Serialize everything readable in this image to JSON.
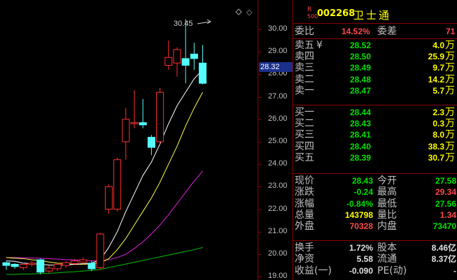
{
  "stock": {
    "market_flag": "R",
    "market_sub": "500",
    "code": "002268",
    "name": "卫士通"
  },
  "axis": {
    "ticks": [
      "30.00",
      "29.00",
      "28.00",
      "27.00",
      "26.00",
      "25.00",
      "24.00",
      "23.00",
      "22.00",
      "21.00",
      "20.00",
      "19.00"
    ],
    "current": "28.32"
  },
  "chart": {
    "peak_label": "30.45",
    "candles": [
      {
        "o": 19.62,
        "c": 19.5,
        "h": 19.68,
        "l": 19.3
      },
      {
        "o": 19.55,
        "c": 19.45,
        "h": 19.6,
        "l": 19.35
      },
      {
        "o": 19.4,
        "c": 19.55,
        "h": 19.62,
        "l": 19.3
      },
      {
        "o": 19.55,
        "c": 19.6,
        "h": 19.7,
        "l": 19.45
      },
      {
        "o": 19.75,
        "c": 19.2,
        "h": 19.8,
        "l": 19.1
      },
      {
        "o": 19.25,
        "c": 19.38,
        "h": 19.5,
        "l": 19.15
      },
      {
        "o": 19.35,
        "c": 19.55,
        "h": 19.62,
        "l": 19.25
      },
      {
        "o": 19.5,
        "c": 19.62,
        "h": 19.7,
        "l": 19.4
      },
      {
        "o": 19.58,
        "c": 19.7,
        "h": 19.78,
        "l": 19.5
      },
      {
        "o": 19.65,
        "c": 19.75,
        "h": 19.85,
        "l": 19.55
      },
      {
        "o": 19.6,
        "c": 19.35,
        "h": 19.7,
        "l": 19.25
      },
      {
        "o": 19.4,
        "c": 20.9,
        "h": 20.95,
        "l": 19.35
      },
      {
        "o": 22.0,
        "c": 23.0,
        "h": 23.1,
        "l": 21.8
      },
      {
        "o": 22.0,
        "c": 24.2,
        "h": 24.3,
        "l": 21.9
      },
      {
        "o": 25.0,
        "c": 26.0,
        "h": 26.5,
        "l": 24.2
      },
      {
        "o": 25.8,
        "c": 25.85,
        "h": 27.3,
        "l": 25.6
      },
      {
        "o": 25.85,
        "c": 25.75,
        "h": 26.9,
        "l": 25.6
      },
      {
        "o": 25.2,
        "c": 24.75,
        "h": 25.3,
        "l": 24.4
      },
      {
        "o": 25.0,
        "c": 27.2,
        "h": 27.4,
        "l": 24.9
      },
      {
        "o": 28.4,
        "c": 28.75,
        "h": 29.5,
        "l": 28.2
      },
      {
        "o": 28.5,
        "c": 29.1,
        "h": 29.2,
        "l": 27.9
      },
      {
        "o": 28.7,
        "c": 28.4,
        "h": 30.45,
        "l": 27.6
      },
      {
        "o": 28.9,
        "c": 28.7,
        "h": 29.4,
        "l": 28.2
      },
      {
        "o": 28.5,
        "c": 27.6,
        "h": 29.3,
        "l": 27.55
      }
    ],
    "ma_white": [
      19.7,
      19.68,
      19.6,
      19.58,
      19.55,
      19.52,
      19.5,
      19.52,
      19.55,
      19.58,
      19.6,
      19.75,
      20.3,
      21.0,
      21.9,
      22.7,
      23.5,
      24.1,
      24.9,
      25.8,
      26.6,
      27.2,
      27.8,
      28.2
    ],
    "ma_yellow": [
      19.85,
      19.82,
      19.8,
      19.75,
      19.72,
      19.65,
      19.6,
      19.58,
      19.55,
      19.55,
      19.57,
      19.62,
      19.8,
      20.2,
      20.7,
      21.3,
      21.9,
      22.5,
      23.2,
      24.0,
      24.8,
      25.7,
      26.5,
      27.2
    ],
    "ma_magenta": [
      19.85,
      19.85,
      19.84,
      19.83,
      19.82,
      19.8,
      19.78,
      19.76,
      19.74,
      19.72,
      19.7,
      19.7,
      19.75,
      19.85,
      20.0,
      20.25,
      20.55,
      20.9,
      21.3,
      21.75,
      22.25,
      22.75,
      23.25,
      23.7
    ],
    "ma_green": [
      19.1,
      19.1,
      19.12,
      19.12,
      19.14,
      19.15,
      19.17,
      19.2,
      19.22,
      19.25,
      19.28,
      19.32,
      19.4,
      19.48,
      19.56,
      19.64,
      19.72,
      19.8,
      19.88,
      19.96,
      20.04,
      20.12,
      20.2,
      20.3
    ]
  },
  "quotes": {
    "weibi_label": "委比",
    "weibi": "14.52%",
    "weicha_label": "委差",
    "weicha": "71",
    "asks": [
      {
        "label": "卖五",
        "price": "28.52",
        "vol": "4.0",
        "unit": "万"
      },
      {
        "label": "卖四",
        "price": "28.50",
        "vol": "25.9",
        "unit": "万"
      },
      {
        "label": "卖三",
        "price": "28.49",
        "vol": "9.7",
        "unit": "万"
      },
      {
        "label": "卖二",
        "price": "28.48",
        "vol": "14.2",
        "unit": "万"
      },
      {
        "label": "卖一",
        "price": "28.47",
        "vol": "5.7",
        "unit": "万"
      }
    ],
    "ask_mark": "¥",
    "bids": [
      {
        "label": "买一",
        "price": "28.44",
        "vol": "2.3",
        "unit": "万"
      },
      {
        "label": "买二",
        "price": "28.43",
        "vol": "0.3",
        "unit": "万"
      },
      {
        "label": "买三",
        "price": "28.41",
        "vol": "8.0",
        "unit": "万"
      },
      {
        "label": "买四",
        "price": "28.40",
        "vol": "38.3",
        "unit": "万"
      },
      {
        "label": "买五",
        "price": "28.39",
        "vol": "30.7",
        "unit": "万"
      }
    ],
    "stats": [
      {
        "l1": "现价",
        "v1": "28.43",
        "c1": "grn",
        "l2": "今开",
        "v2": "27.58",
        "c2": "grn"
      },
      {
        "l1": "涨跌",
        "v1": "-0.24",
        "c1": "grn",
        "l2": "最高",
        "v2": "29.34",
        "c2": "red"
      },
      {
        "l1": "涨幅",
        "v1": "-0.84%",
        "c1": "grn",
        "l2": "最低",
        "v2": "27.56",
        "c2": "grn"
      },
      {
        "l1": "总量",
        "v1": "143798",
        "c1": "yel",
        "l2": "量比",
        "v2": "1.34",
        "c2": "red"
      },
      {
        "l1": "外盘",
        "v1": "70328",
        "c1": "red",
        "l2": "内盘",
        "v2": "73470",
        "c2": "grn"
      }
    ],
    "stats2": [
      {
        "l1": "换手",
        "v1": "1.72%",
        "c1": "wht",
        "l2": "股本",
        "v2": "8.46亿",
        "c2": "wht"
      },
      {
        "l1": "净资",
        "v1": "5.58",
        "c1": "wht",
        "l2": "流通",
        "v2": "8.37亿",
        "c2": "wht"
      },
      {
        "l1": "收益(一)",
        "v1": "-0.090",
        "c1": "wht",
        "l2": "PE(动)",
        "v2": "-",
        "c2": "wht"
      }
    ]
  }
}
